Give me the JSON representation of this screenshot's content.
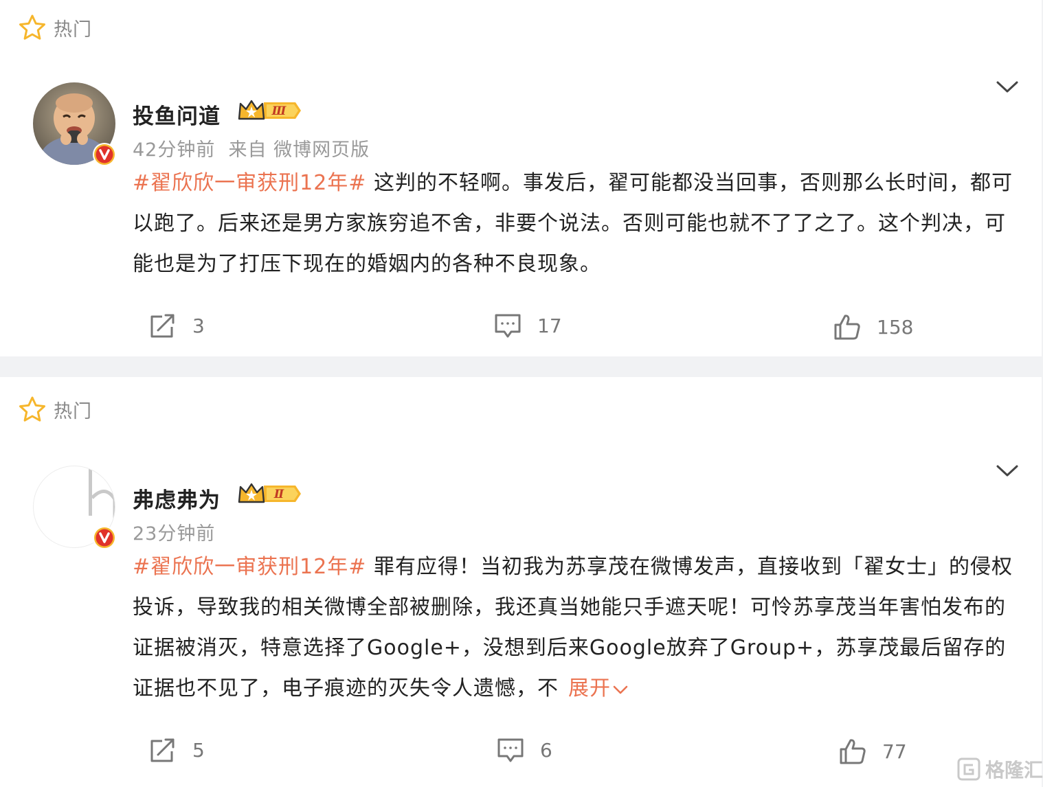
{
  "colors": {
    "accent": "#eb7350",
    "verified": "#e0322a",
    "crown": "#f6b62c",
    "icon_gray": "#777777"
  },
  "posts": [
    {
      "hot_label": "热门",
      "username": "投鱼问道",
      "member_level": "Ⅲ",
      "time": "42分钟前",
      "source": "来自 微博网页版",
      "topic": "#翟欣欣一审获刑12年#",
      "body": " 这判的不轻啊。事发后，翟可能都没当回事，否则那么长时间，都可以跑了。后来还是男方家族穷追不舍，非要个说法。否则可能也就不了了之了。这个判决，可能也是为了打压下现在的婚姻内的各种不良现象。",
      "expand_label": "",
      "reposts": "3",
      "comments": "17",
      "likes": "158"
    },
    {
      "hot_label": "热门",
      "username": "弗虑弗为",
      "member_level": "Ⅱ",
      "time": "23分钟前",
      "source": "",
      "topic": "#翟欣欣一审获刑12年#",
      "body": " 罪有应得！当初我为苏享茂在微博发声，直接收到「翟女士」的侵权投诉，导致我的相关微博全部被删除，我还真当她能只手遮天呢！可怜苏享茂当年害怕发布的证据被消灭，特意选择了Google+，没想到后来Google放弃了Group+，苏享茂最后留存的证据也不见了，电子痕迹的灭失令人遗憾，不",
      "expand_label": "展开",
      "reposts": "5",
      "comments": "6",
      "likes": "77"
    }
  ],
  "watermark": "格隆汇"
}
